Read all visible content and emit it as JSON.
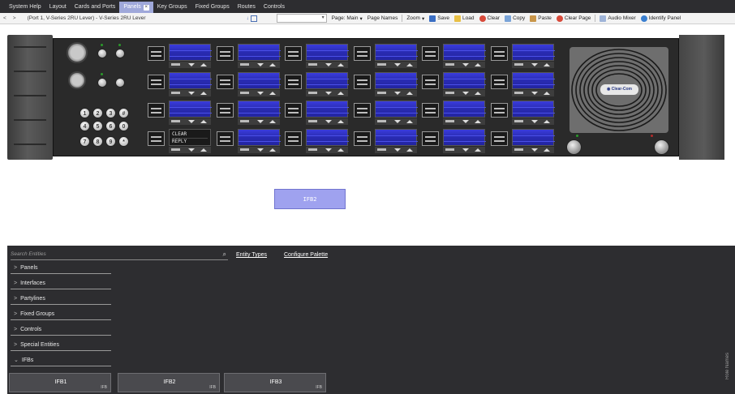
{
  "menu_tabs": [
    {
      "label": "System Help"
    },
    {
      "label": "Layout"
    },
    {
      "label": "Cards and Ports"
    },
    {
      "label": "Panels",
      "active": true,
      "close": "×"
    },
    {
      "label": "Key Groups"
    },
    {
      "label": "Fixed Groups"
    },
    {
      "label": "Routes"
    },
    {
      "label": "Controls"
    }
  ],
  "toolbar": {
    "back": "<",
    "forward": ">",
    "title": "(Port 1, V-Series 2RU Lever)  - V-Series 2RU Lever",
    "sort_glyph": "↓",
    "page_label": "Page: Main",
    "page_names_label": "Page Names",
    "zoom_label": "Zoom",
    "save_label": "Save",
    "load_label": "Load",
    "clear_label": "Clear",
    "copy_label": "Copy",
    "paste_label": "Paste",
    "clear_page_label": "Clear Page",
    "audio_mixer_label": "Audio Mixer",
    "identify_panel_label": "Identify Panel"
  },
  "device": {
    "keypad": [
      "1",
      "2",
      "3",
      "#",
      "4",
      "5",
      "6",
      "0",
      "7",
      "8",
      "9",
      "*"
    ],
    "text_key": {
      "line1": "CLEAR",
      "line2": "REPLY"
    },
    "logo_text": "◉ Clear-Com"
  },
  "canvas": {
    "ifb_block_label": "IFB2"
  },
  "palette": {
    "search_placeholder": "Search Entities",
    "entity_types_link": "Entity Types",
    "configure_palette_link": "Configure Palette",
    "categories": [
      {
        "label": "Panels",
        "chevron": ">"
      },
      {
        "label": "Interfaces",
        "chevron": ">"
      },
      {
        "label": "Partylines",
        "chevron": ">"
      },
      {
        "label": "Fixed Groups",
        "chevron": ">"
      },
      {
        "label": "Controls",
        "chevron": ">"
      },
      {
        "label": "Special Entities",
        "chevron": ">"
      },
      {
        "label": "IFBs",
        "chevron": "⌄"
      }
    ],
    "ifb_items": [
      {
        "name": "IFB1",
        "type": "IFB"
      },
      {
        "name": "IFB2",
        "type": "IFB"
      },
      {
        "name": "IFB3",
        "type": "IFB"
      }
    ],
    "side_tab_label": "Role Names"
  },
  "colors": {
    "active_tab": "#9fa8da",
    "display_blue": "#2a2cb4",
    "palette_bg": "#2d2d30",
    "ifb_block": "#9fa2ef"
  }
}
